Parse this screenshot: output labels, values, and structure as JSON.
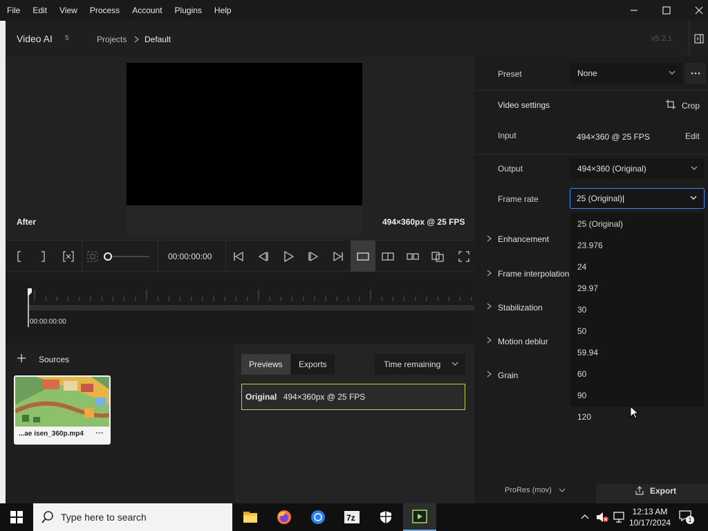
{
  "menu": [
    "File",
    "Edit",
    "View",
    "Process",
    "Account",
    "Plugins",
    "Help"
  ],
  "header": {
    "app_title": "Video AI",
    "badge": "5",
    "breadcrumb_projects": "Projects",
    "breadcrumb_current": "Default",
    "version": "v5.2.1"
  },
  "preview": {
    "after_label": "After",
    "resolution_label": "494×360px @ 25 FPS"
  },
  "controls": {
    "timecode": "00:00:00:00"
  },
  "timeline": {
    "timecode": "00:00:00:00"
  },
  "sources": {
    "title": "Sources",
    "file_name": "...ae isen_360p.mp4",
    "more": "···"
  },
  "previews_panel": {
    "tab_previews": "Previews",
    "tab_exports": "Exports",
    "time_select": "Time remaining",
    "original_label": "Original",
    "original_info": "494×360px @ 25 FPS"
  },
  "right_panel": {
    "preset_label": "Preset",
    "preset_value": "None",
    "video_settings": "Video settings",
    "crop": "Crop",
    "input_label": "Input",
    "input_value": "494×360 @ 25 FPS",
    "edit": "Edit",
    "output_label": "Output",
    "output_value": "494×360 (Original)",
    "framerate_label": "Frame rate",
    "framerate_value": "25 (Original)",
    "sections": [
      "Enhancement",
      "Frame interpolation",
      "Stabilization",
      "Motion deblur",
      "Grain"
    ],
    "bottom_format": "ProRes (mov)",
    "export": "Export"
  },
  "dropdown": {
    "options": [
      "25 (Original)",
      "23.976",
      "24",
      "29.97",
      "30",
      "50",
      "59.94",
      "60",
      "90",
      "120"
    ]
  },
  "taskbar": {
    "search_placeholder": "Type here to search",
    "time": "12:13 AM",
    "date": "10/17/2024",
    "notification_count": "1"
  },
  "colors": {
    "accent_green": "#b8d44a",
    "focus_blue": "#3b8cff",
    "panel_bg": "#1c1c1c"
  }
}
